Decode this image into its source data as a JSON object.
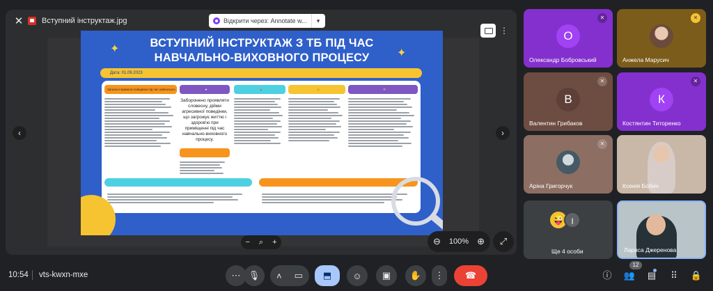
{
  "viewer": {
    "file_name": "Вступний інструктаж.jpg",
    "open_with_label": "Відкрити через: Annotate w...",
    "zoom_level": "100%",
    "icons": [
      "close-icon",
      "print-icon",
      "kebab-icon",
      "chevron-left-icon",
      "chevron-right-icon",
      "zoom-out-icon",
      "zoom-in-icon",
      "fullscreen-icon"
    ]
  },
  "poster": {
    "title_line1": "ВСТУПНИЙ ІНСТРУКТАЖ З ТБ ПІД ЧАС",
    "title_line2": "НАВЧАЛЬНО-ВИХОВНОГО ПРОЦЕСУ",
    "date": "Дата: 01.09.2023",
    "col1_heading": "Загальні правила поведінки під час навчально-виховного процесу:",
    "col2_body": "Заборонено проявляти словесну, дійми агресивної поведінки, що загрожує життю і здоров'ю при приміщенні під час навчально-виховного процесу."
  },
  "participants": [
    {
      "name": "Олександр Бобровський",
      "initial": "О",
      "color": "#8430ce"
    },
    {
      "name": "Анжела Марусич",
      "initial": "",
      "color": "#7b5c1a"
    },
    {
      "name": "Валентин Грибаков",
      "initial": "В",
      "color": "#6d4c41"
    },
    {
      "name": "Костянтин Титоренко",
      "initial": "К",
      "color": "#8430ce"
    },
    {
      "name": "Аріна Григорчук",
      "initial": "",
      "color": "#8d6e63"
    },
    {
      "name": "Ксенія Бобич",
      "initial": "",
      "color": "#c9b8a8"
    },
    {
      "name": "Ще 4 особи",
      "initial": "І",
      "color": "#3c4043"
    },
    {
      "name": "Лариса Джеренова",
      "initial": "",
      "color": "#b9c4c8"
    }
  ],
  "bottom_bar": {
    "time": "10:54",
    "meeting_code": "vts-kwxn-mxe",
    "participants_count": "12",
    "icons": [
      "more-options-icon",
      "mic-icon",
      "chevron-up-icon",
      "camera-icon",
      "present-icon",
      "emoji-icon",
      "captions-icon",
      "raise-hand-icon",
      "kebab-icon",
      "end-call-icon",
      "info-icon",
      "people-icon",
      "chat-icon",
      "activities-icon",
      "host-controls-icon"
    ]
  }
}
